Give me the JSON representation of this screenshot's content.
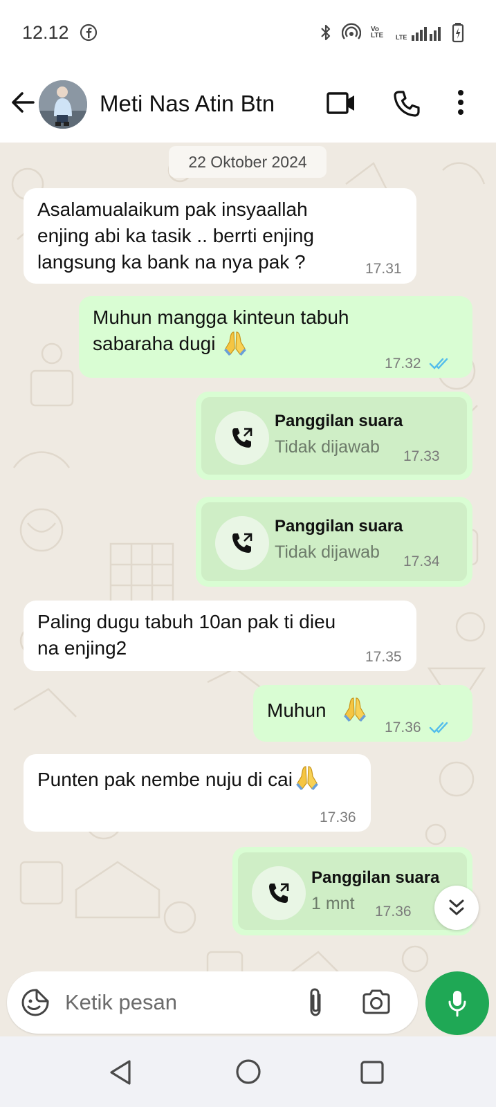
{
  "status_bar": {
    "time": "12.12",
    "icons": [
      "facebook-icon",
      "bluetooth-icon",
      "hotspot-icon",
      "volte-icon",
      "lte-signal-icon",
      "battery-charging-icon"
    ],
    "volte_label": "Vo LTE",
    "lte_label": "LTE"
  },
  "header": {
    "contact_name": "Meti Nas Atin Btn",
    "icons": [
      "back-arrow-icon",
      "avatar",
      "video-call-icon",
      "voice-call-icon",
      "more-options-icon"
    ]
  },
  "chat": {
    "date_label": "22 Oktober 2024",
    "messages": [
      {
        "direction": "incoming",
        "text": "Asalamualaikum pak insyaallah\nenjing abi ka tasik .. berrti enjing\nlangsung ka bank na nya pak ?",
        "time": "17.31"
      },
      {
        "direction": "outgoing",
        "text": "Muhun mangga kinteun tabuh\nsabaraha dugi",
        "emoji": "folded-hands-icon",
        "time": "17.32",
        "status": "read"
      },
      {
        "direction": "outgoing",
        "type": "call",
        "title": "Panggilan suara",
        "subtitle": "Tidak dijawab",
        "time": "17.33"
      },
      {
        "direction": "outgoing",
        "type": "call",
        "title": "Panggilan suara",
        "subtitle": "Tidak dijawab",
        "time": "17.34"
      },
      {
        "direction": "incoming",
        "text": "Paling dugu tabuh 10an pak ti dieu\nna enjing2",
        "time": "17.35"
      },
      {
        "direction": "outgoing",
        "text": "Muhun",
        "emoji": "folded-hands-icon",
        "time": "17.36",
        "status": "read"
      },
      {
        "direction": "incoming",
        "text": "Punten pak nembe nuju di cai",
        "emoji": "folded-hands-icon",
        "time": "17.36"
      },
      {
        "direction": "outgoing",
        "type": "call",
        "title": "Panggilan suara",
        "subtitle": "1 mnt",
        "time": "17.36"
      }
    ]
  },
  "composer": {
    "placeholder": "Ketik pesan",
    "icons": [
      "sticker-icon",
      "attach-icon",
      "camera-icon",
      "mic-icon"
    ]
  },
  "colors": {
    "incoming_bubble": "#ffffff",
    "outgoing_bubble": "#d9fdd3",
    "chat_background": "#efeae2",
    "read_ticks": "#53bdeb",
    "mic_button": "#1fa855"
  }
}
